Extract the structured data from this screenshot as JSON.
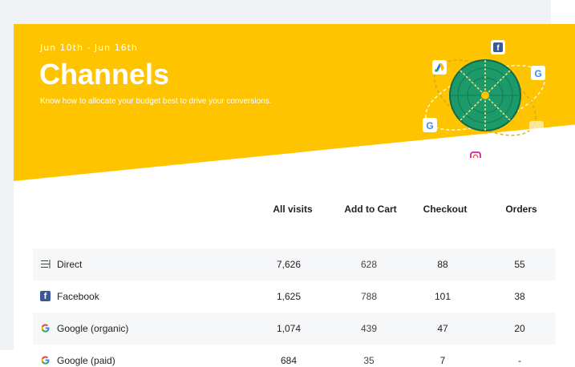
{
  "header": {
    "date_range": "Jun 10th - Jun 16th",
    "title": "Channels",
    "subtitle": "Know how to allocate your budget best to drive your conversions."
  },
  "table": {
    "columns": [
      "All visits",
      "Add to Cart",
      "Checkout",
      "Orders"
    ],
    "rows": [
      {
        "channel": "Direct",
        "icon": "direct-icon",
        "all_visits": "7,626",
        "add_to_cart": "628",
        "checkout": "88",
        "orders": "55"
      },
      {
        "channel": "Facebook",
        "icon": "facebook-icon",
        "all_visits": "1,625",
        "add_to_cart": "788",
        "checkout": "101",
        "orders": "38"
      },
      {
        "channel": "Google (organic)",
        "icon": "google-icon",
        "all_visits": "1,074",
        "add_to_cart": "439",
        "checkout": "47",
        "orders": "20"
      },
      {
        "channel": "Google (paid)",
        "icon": "google-icon",
        "all_visits": "684",
        "add_to_cart": "35",
        "checkout": "7",
        "orders": "-"
      }
    ]
  },
  "colors": {
    "banner": "#fec400",
    "globe": "#1c9a6a",
    "facebook": "#3b5998"
  },
  "illustration_icons": [
    "facebook-icon",
    "google-icon",
    "google-ads-icon",
    "instagram-icon",
    "globe-icon"
  ]
}
